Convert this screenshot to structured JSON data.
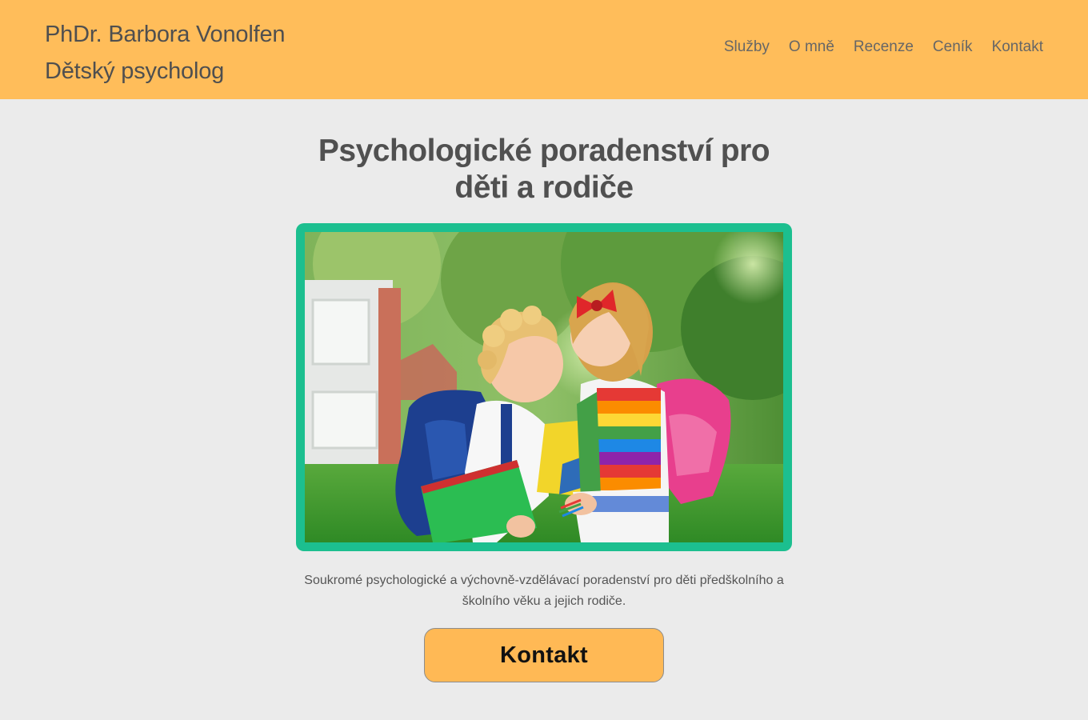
{
  "header": {
    "name": "PhDr. Barbora Vonolfen",
    "subtitle": "Dětský psycholog",
    "background_color": "#ffbd5a"
  },
  "nav": {
    "items": [
      {
        "label": "Služby"
      },
      {
        "label": "O mně"
      },
      {
        "label": "Recenze"
      },
      {
        "label": "Ceník"
      },
      {
        "label": "Kontakt"
      }
    ]
  },
  "hero": {
    "title_line1": "Psychologické poradenství pro",
    "title_line2": "děti a rodiče",
    "image_alt": "Two children with school backpacks outdoors",
    "frame_color": "#1cbf8f",
    "description": "Soukromé psychologické a výchovně-vzdělávací poradenství pro děti předškolního a školního věku a jejich rodiče.",
    "cta_label": "Kontakt",
    "cta_color": "#ffb955"
  }
}
